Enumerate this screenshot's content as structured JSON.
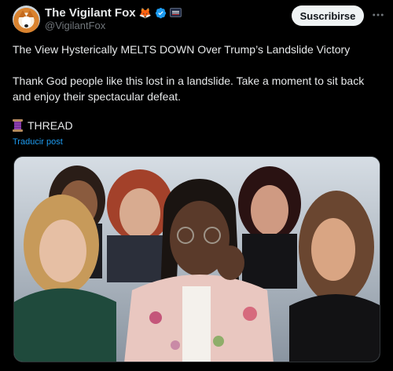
{
  "author": {
    "display_name": "The Vigilant Fox",
    "handle": "@VigilantFox",
    "emoji": "🦊",
    "avatar_icon": "fox-avatar-icon",
    "verified_icon": "verified-badge-icon",
    "affiliation_icon": "flag-badge-icon"
  },
  "actions": {
    "subscribe_label": "Suscribirse",
    "more_icon": "more-options-icon"
  },
  "post": {
    "line1": "The View Hysterically MELTS DOWN Over Trump’s Landslide Victory",
    "line2": "Thank God people like this lost in a landslide. Take a moment to sit back and enjoy their spectacular defeat.",
    "thread_label": "THREAD",
    "thread_icon": "spool-of-thread-icon",
    "translate_label": "Traducir post"
  },
  "media": {
    "type": "photo",
    "icon": "tv-panel-photo"
  },
  "colors": {
    "background": "#000000",
    "text": "#e7e9ea",
    "secondary": "#71767b",
    "link": "#1d9bf0",
    "verified": "#1d9bf0",
    "button_bg": "#eff3f4"
  }
}
